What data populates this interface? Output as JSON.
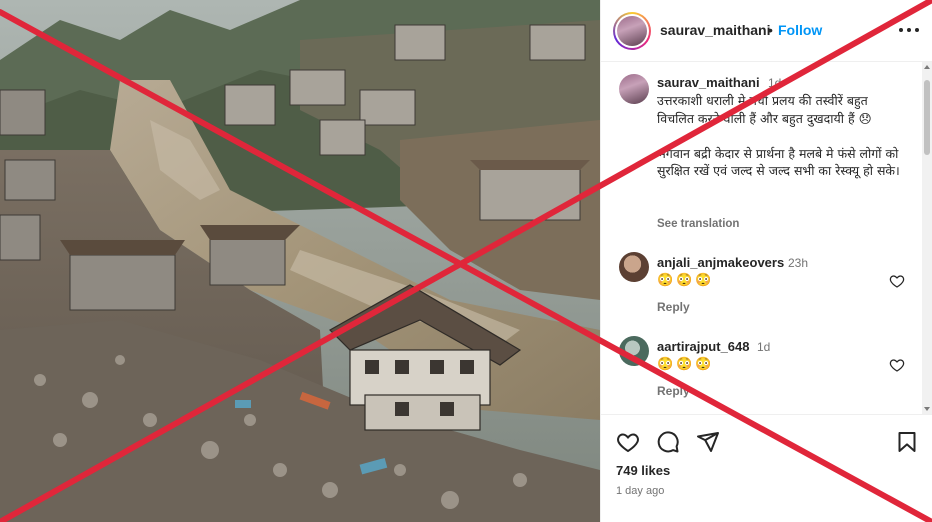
{
  "post": {
    "username": "saurav_maithani",
    "separator": "•",
    "follow_label": "Follow",
    "more_icon": "more-options-icon"
  },
  "caption": {
    "username": "saurav_maithani",
    "time": "1d",
    "text": "उत्तरकाशी धराली मे मची प्रलय की तस्वीरें बहुत विचलित करने वाली हैं और बहुत दुखदायी हैं 😞\n\nभगवान बद्री केदार से प्रार्थना है मलबे मे फंसे लोगों को सुरक्षित रखें एवं जल्द से जल्द सभी का रेस्क्यू हो सके।",
    "see_translation": "See translation"
  },
  "comments": [
    {
      "username": "anjali_anjmakeovers",
      "time": "23h",
      "emojis": "😳😳😳",
      "reply": "Reply",
      "avatar_color": "#8a6a5a"
    },
    {
      "username": "aartirajput_648",
      "time": "1d",
      "emojis": "😳😳😳",
      "reply": "Reply",
      "avatar_color": "#6e8a7a"
    }
  ],
  "actions": {
    "like_icon": "heart-icon",
    "comment_icon": "comment-icon",
    "share_icon": "share-icon",
    "save_icon": "bookmark-icon"
  },
  "likes": "749 likes",
  "posted": "1 day ago",
  "colors": {
    "cross": "#e0263a",
    "link": "#0095f6",
    "text": "#262626",
    "muted": "#737373"
  }
}
